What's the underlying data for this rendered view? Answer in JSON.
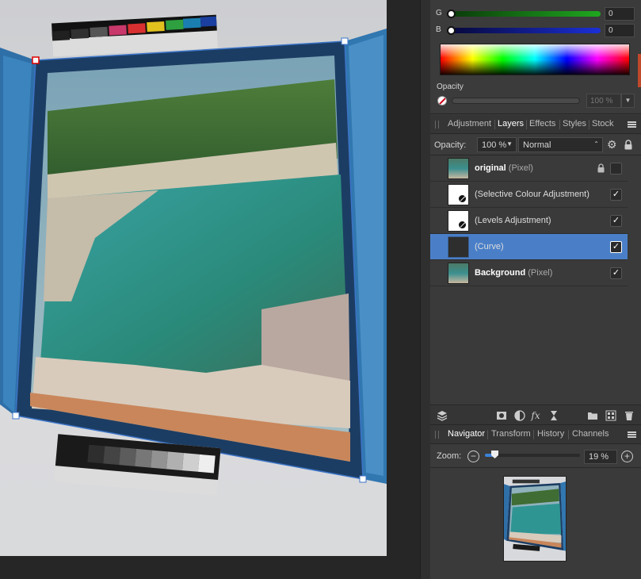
{
  "color": {
    "channels": [
      {
        "label": "G",
        "value": "0"
      },
      {
        "label": "B",
        "value": "0"
      }
    ],
    "opacity_label": "Opacity",
    "opacity_value": "100 %"
  },
  "studio_tabs": {
    "tabs": [
      "Adjustment",
      "Layers",
      "Effects",
      "Styles",
      "Stock"
    ],
    "active": "Layers"
  },
  "layer_options": {
    "opacity_label": "Opacity:",
    "opacity_value": "100 %",
    "blend_mode": "Normal"
  },
  "layers": [
    {
      "name": "original",
      "type": "(Pixel)",
      "bold": true,
      "locked": true,
      "visible": false,
      "selected": false,
      "thumb": "photo"
    },
    {
      "name": "(Selective Colour Adjustment)",
      "type": "",
      "bold": false,
      "locked": false,
      "visible": true,
      "selected": false,
      "thumb": "adjustment"
    },
    {
      "name": "(Levels Adjustment)",
      "type": "",
      "bold": false,
      "locked": false,
      "visible": true,
      "selected": false,
      "thumb": "adjustment"
    },
    {
      "name": "(Curve)",
      "type": "",
      "bold": false,
      "locked": false,
      "visible": true,
      "selected": true,
      "thumb": "curve"
    },
    {
      "name": "Background",
      "type": "(Pixel)",
      "bold": true,
      "locked": false,
      "visible": true,
      "selected": false,
      "thumb": "photo"
    }
  ],
  "nav_tabs": {
    "tabs": [
      "Navigator",
      "Transform",
      "History",
      "Channels"
    ],
    "active": "Navigator"
  },
  "navigator": {
    "zoom_label": "Zoom:",
    "zoom_value": "19 %"
  },
  "icons": {
    "check": "✓",
    "gear": "⚙",
    "fx": "fx",
    "minus": "−",
    "plus": "+",
    "dropdown": "▼",
    "stepper": "⌃"
  },
  "colors": {
    "selection": "#4a7fc8",
    "accent_blue": "#3c82d8",
    "green_channel": "#1fa81f",
    "blue_channel": "#1b2fd6"
  }
}
